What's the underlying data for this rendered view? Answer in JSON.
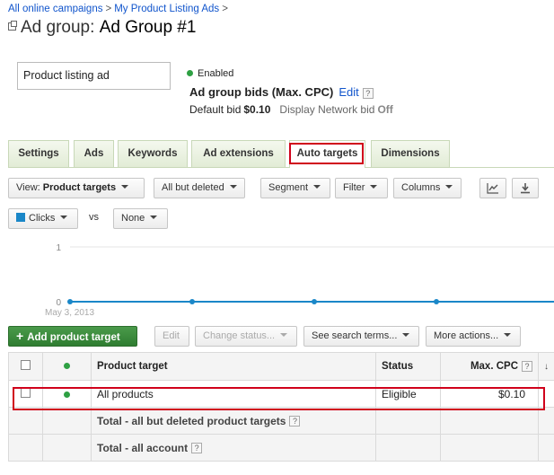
{
  "breadcrumb": {
    "item1": "All online campaigns",
    "sep": ">",
    "item2": "My Product Listing Ads",
    "trailing": ">"
  },
  "title": {
    "prefix": "Ad group:",
    "name": "Ad Group #1"
  },
  "ad_preview": {
    "text": "Product listing ad"
  },
  "status": {
    "label": "Enabled",
    "color": "#2ea043"
  },
  "bids": {
    "title": "Ad group bids (Max. CPC)",
    "edit": "Edit",
    "help": "?",
    "default_label": "Default bid",
    "default_value": "$0.10",
    "display_label": "Display Network bid",
    "display_value": "Off"
  },
  "tabs": [
    "Settings",
    "Ads",
    "Keywords",
    "Ad extensions",
    "Auto targets",
    "Dimensions"
  ],
  "active_tab": "Auto targets",
  "highlight_color": "#d0021b",
  "toolbar": {
    "view_label": "View:",
    "view_value": "Product targets",
    "filter_status": "All but deleted",
    "segment": "Segment",
    "filter": "Filter",
    "columns": "Columns"
  },
  "metric": {
    "primary": "Clicks",
    "vs": "vs",
    "secondary": "None",
    "primary_color": "#1a87c8"
  },
  "chart_data": {
    "type": "line",
    "x": [
      "May 3, 2013",
      "",
      "",
      "",
      "",
      ""
    ],
    "series": [
      {
        "values": [
          0,
          0,
          0,
          0,
          0,
          0
        ]
      }
    ],
    "ylim": [
      0,
      1
    ],
    "yticks": [
      "1",
      "0"
    ],
    "xlabel_first": "May 3, 2013",
    "grid": true
  },
  "actions": {
    "add": "Add product target",
    "edit": "Edit",
    "change_status": "Change status...",
    "see_terms": "See search terms...",
    "more": "More actions..."
  },
  "table": {
    "headers": {
      "target": "Product target",
      "status": "Status",
      "cpc": "Max. CPC",
      "help": "?"
    },
    "row": {
      "target": "All products",
      "status": "Eligible",
      "cpc": "$0.10"
    },
    "total1": "Total - all but deleted product targets",
    "total2": "Total - all account",
    "help": "?"
  }
}
